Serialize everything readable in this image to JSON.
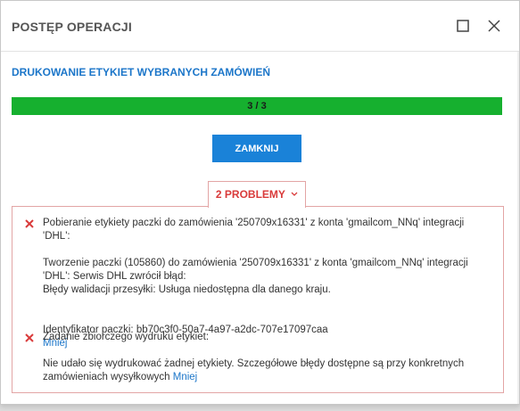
{
  "window": {
    "title": "POSTĘP OPERACJI"
  },
  "operation": {
    "title": "DRUKOWANIE ETYKIET WYBRANYCH ZAMÓWIEŃ"
  },
  "progress": {
    "label": "3 / 3",
    "fraction": 1.0,
    "color": "#16b02f"
  },
  "buttons": {
    "close_label": "ZAMKNIJ"
  },
  "problems": {
    "toggle_label": "2 PROBLEMY",
    "items": [
      {
        "heading": "Pobieranie etykiety paczki do zamówienia '250709x16331' z konta 'gmailcom_NNq' integracji\n'DHL':",
        "detail": "Tworzenie paczki (105860) do zamówienia '250709x16331' z konta 'gmailcom_NNq' integracji\n'DHL': Serwis DHL zwrócił błąd:\nBłędy walidacji przesyłki: Usługa niedostępna dla danego kraju.",
        "identifier": "Identyfikator paczki: bb70c3f0-50a7-4a97-a2dc-707e17097caa",
        "less_link": "Mniej"
      },
      {
        "heading": "Zadanie zbiorczego wydruku etykiet:",
        "detail": "Nie udało się wydrukować żadnej etykiety. Szczegółowe błędy dostępne są przy konkretnych\nzamówieniach wysyłkowych",
        "less_link": "Mniej"
      }
    ]
  },
  "colors": {
    "accent": "#1c76c9",
    "error": "#d93a3a",
    "button": "#1a82d8"
  },
  "icons": {
    "maximize": "maximize-icon",
    "close": "close-icon",
    "error": "error-x-icon",
    "chevron": "chevron-down-icon"
  }
}
